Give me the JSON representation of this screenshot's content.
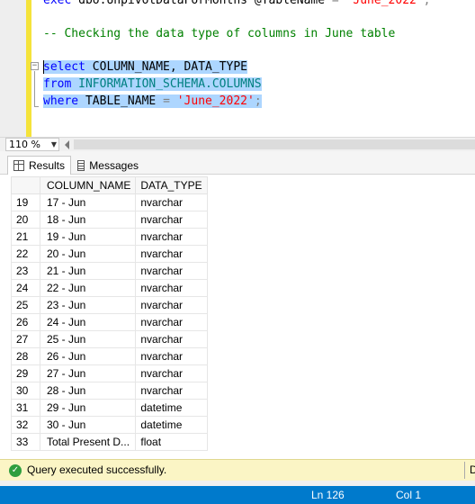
{
  "editor": {
    "lines": [
      {
        "kind": "exec",
        "text": "exec dbo.UnpivotDataForMonths @TableName = 'June_2022';"
      },
      {
        "kind": "comment",
        "text": "-- Checking the data type of columns in June table"
      },
      {
        "kind": "select",
        "kw": "select",
        "rest": " COLUMN_NAME, DATA_TYPE"
      },
      {
        "kind": "from",
        "kw": "from",
        "rest": " INFORMATION_SCHEMA.COLUMNS"
      },
      {
        "kind": "where",
        "kw": "where",
        "col": " TABLE_NAME ",
        "op": "=",
        "str": " 'June_2022'",
        "end": ";"
      }
    ],
    "exec_parts": {
      "kw": "exec",
      "proc": " dbo.UnpivotDataForMonths ",
      "param": "@TableName",
      "op": " = ",
      "str": "'June_2022'",
      "end": ";"
    }
  },
  "zoom": {
    "value": "110 %"
  },
  "tabs": [
    {
      "label": "Results",
      "icon": "grid-icon"
    },
    {
      "label": "Messages",
      "icon": "messages-icon"
    }
  ],
  "grid": {
    "columns": [
      "COLUMN_NAME",
      "DATA_TYPE"
    ],
    "rows": [
      {
        "n": "19",
        "col": "17 - Jun",
        "type": "nvarchar"
      },
      {
        "n": "20",
        "col": "18 - Jun",
        "type": "nvarchar"
      },
      {
        "n": "21",
        "col": "19 - Jun",
        "type": "nvarchar"
      },
      {
        "n": "22",
        "col": "20 - Jun",
        "type": "nvarchar"
      },
      {
        "n": "23",
        "col": "21 - Jun",
        "type": "nvarchar"
      },
      {
        "n": "24",
        "col": "22 - Jun",
        "type": "nvarchar"
      },
      {
        "n": "25",
        "col": "23 - Jun",
        "type": "nvarchar"
      },
      {
        "n": "26",
        "col": "24 - Jun",
        "type": "nvarchar"
      },
      {
        "n": "27",
        "col": "25 - Jun",
        "type": "nvarchar"
      },
      {
        "n": "28",
        "col": "26 - Jun",
        "type": "nvarchar"
      },
      {
        "n": "29",
        "col": "27 - Jun",
        "type": "nvarchar"
      },
      {
        "n": "30",
        "col": "28 - Jun",
        "type": "nvarchar"
      },
      {
        "n": "31",
        "col": "29 - Jun",
        "type": "datetime"
      },
      {
        "n": "32",
        "col": "30 - Jun",
        "type": "datetime"
      },
      {
        "n": "33",
        "col": "Total Present D...",
        "type": "float"
      }
    ]
  },
  "status": {
    "query_message": "Query executed successfully.",
    "truncated_right": "D",
    "ln": "Ln 126",
    "col": "Col 1"
  },
  "colors": {
    "keyword": "#0000ff",
    "system_object": "#008080",
    "string": "#ff0000",
    "comment": "#008000",
    "selection": "#add6ff",
    "status_bar": "#007acc",
    "query_ok_bar": "#fbf5c5"
  }
}
